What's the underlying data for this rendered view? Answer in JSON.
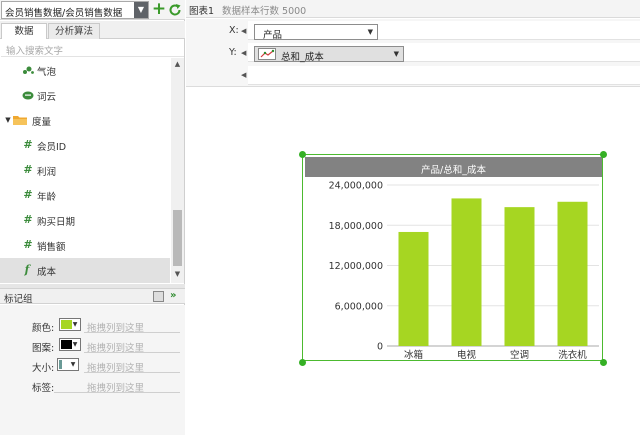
{
  "toolbar": {
    "dataset_value": "会员销售数据/会员销售数据",
    "add_label": "+"
  },
  "tabs": [
    {
      "label": "数据"
    },
    {
      "label": "分析算法"
    }
  ],
  "search": {
    "placeholder": "输入搜索文字"
  },
  "field_list": [
    {
      "label": "气泡",
      "icon": "bubble-icon"
    },
    {
      "label": "词云",
      "icon": "wordcloud-icon"
    },
    {
      "label": "度量",
      "icon": "folder-icon",
      "expanded": true
    },
    {
      "label": "会员ID",
      "icon": "hash-icon"
    },
    {
      "label": "利润",
      "icon": "hash-icon"
    },
    {
      "label": "年龄",
      "icon": "hash-icon"
    },
    {
      "label": "购买日期",
      "icon": "hash-icon"
    },
    {
      "label": "销售额",
      "icon": "hash-icon"
    },
    {
      "label": "成本",
      "icon": "function-icon",
      "selected": true
    }
  ],
  "marks_group": {
    "title": "标记组",
    "rows": [
      {
        "label": "颜色:",
        "placeholder": "拖拽列到这里",
        "swatch": "#a6d622"
      },
      {
        "label": "图案:",
        "placeholder": "拖拽列到这里",
        "swatch": "#000000"
      },
      {
        "label": "大小:",
        "placeholder": "拖拽列到这里",
        "swatch": "#6a9a96"
      },
      {
        "label": "标签:",
        "placeholder": "拖拽列到这里"
      }
    ]
  },
  "chart_header": {
    "name": "图表1",
    "sample_info": "数据样本行数 5000"
  },
  "shelves": {
    "x_label": "X:",
    "x_field": "产品",
    "y_label": "Y:",
    "y_field": "总和_成本"
  },
  "colors": {
    "accent_green": "#4cba2f",
    "bar_color": "#a6d622",
    "header_gray": "#828282"
  },
  "chart_data": {
    "type": "bar",
    "title": "产品/总和_成本",
    "categories": [
      "冰箱",
      "电视",
      "空调",
      "洗衣机"
    ],
    "values": [
      17000000,
      22000000,
      20700000,
      21500000
    ],
    "ylim": [
      0,
      24000000
    ],
    "yticks": [
      0,
      6000000,
      12000000,
      18000000,
      24000000
    ],
    "ytick_labels": [
      "0",
      "6,000,000",
      "12,000,000",
      "18,000,000",
      "24,000,000"
    ],
    "grid": true,
    "legend": "none"
  }
}
